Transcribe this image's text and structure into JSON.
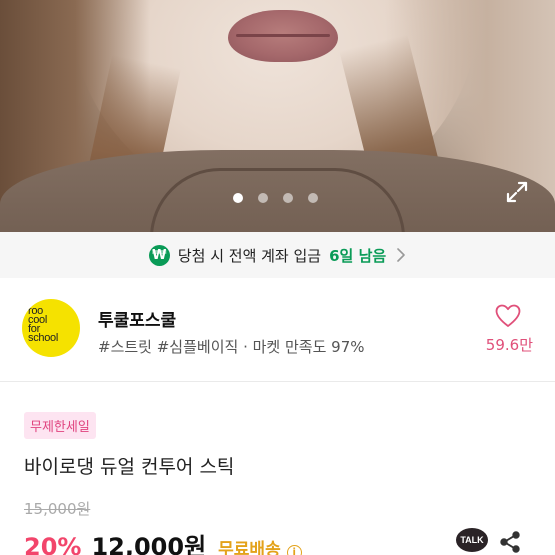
{
  "hero": {
    "carousel_count": 4,
    "carousel_active_index": 0
  },
  "promo": {
    "icon": "won-icon",
    "text": "당첨 시 전액 계좌 입금",
    "highlight": "6일 남음",
    "accent_color": "#0a9b57"
  },
  "shop": {
    "logo_lines": [
      "roo",
      "cool",
      "for",
      "school"
    ],
    "name": "투쿨포스쿨",
    "tags": "#스트릿 #심플베이직 · 마켓 만족도 97%",
    "likes": "59.6만",
    "logo_color": "#f5e200"
  },
  "product": {
    "badge": "무제한세일",
    "title": "바이로댕 듀얼 컨투어 스틱",
    "original_price": "15,000원",
    "discount": "20%",
    "price": "12,000원",
    "shipping": "무료배송",
    "info_glyph": "i",
    "talk_label": "TALK"
  },
  "colors": {
    "discount": "#f2456b",
    "shipping": "#e3a21a",
    "likes": "#e0507a"
  }
}
